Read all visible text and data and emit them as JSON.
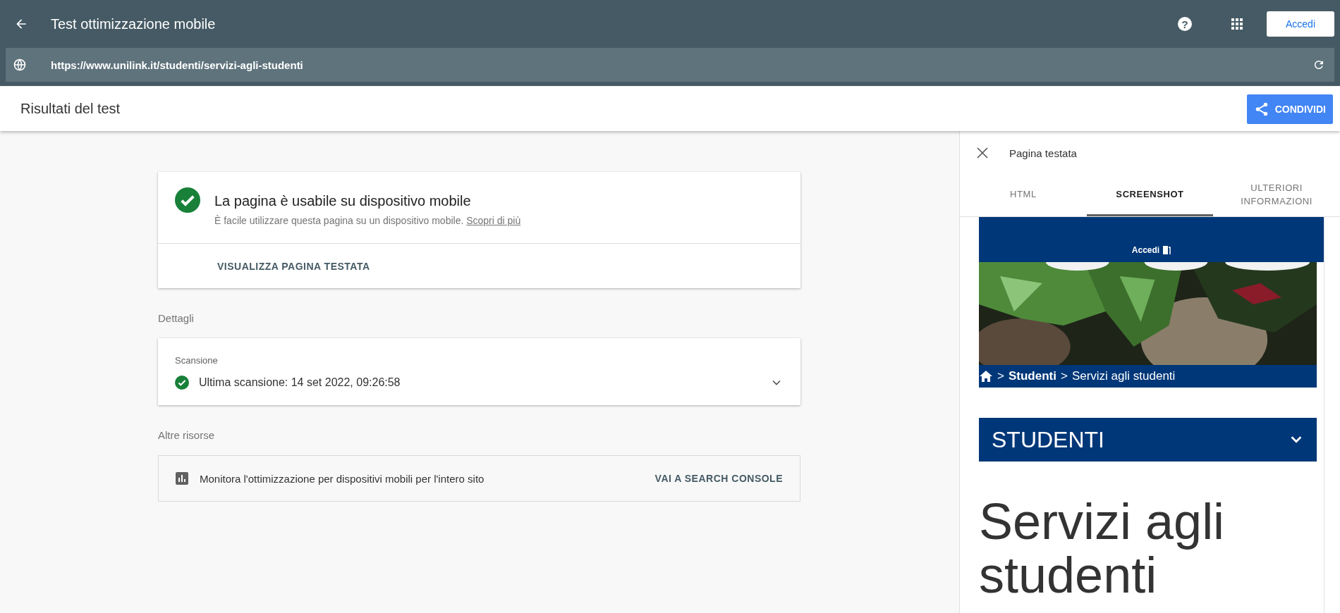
{
  "app_bar": {
    "title": "Test ottimizzazione mobile",
    "help": "?",
    "sign_in": "Accedi"
  },
  "url_bar": {
    "value": "https://www.unilink.it/studenti/servizi-agli-studenti"
  },
  "results_header": {
    "title": "Risultati del test",
    "share": "CONDIVIDI"
  },
  "verdict_card": {
    "title": "La pagina è usabile su dispositivo mobile",
    "text": "È facile utilizzare questa pagina su un dispositivo mobile.",
    "link": "Scopri di più",
    "action": "VISUALIZZA PAGINA TESTATA"
  },
  "details": {
    "heading": "Dettagli",
    "card_label": "Scansione",
    "row": "Ultima scansione: 14 set 2022, 09:26:58",
    "expanded": false
  },
  "resources": {
    "heading": "Altre risorse",
    "text": "Monitora l'ottimizzazione per dispositivi mobili per l'intero sito",
    "action": "VAI A SEARCH CONSOLE"
  },
  "side_panel": {
    "title": "Pagina testata",
    "tabs": [
      {
        "label": "HTML",
        "selected": false
      },
      {
        "label": "SCREENSHOT",
        "selected": true
      },
      {
        "label": "ULTERIORI INFORMAZIONI",
        "selected": false
      }
    ],
    "screenshot": {
      "sign_in": "Accedi",
      "breadcrumb_sep_1": ">",
      "breadcrumb_current_section": "Studenti",
      "breadcrumb_sep_2": ">",
      "breadcrumb_page": "Servizi agli studenti",
      "section": "STUDENTI",
      "heading": "Servizi agli studenti"
    }
  }
}
